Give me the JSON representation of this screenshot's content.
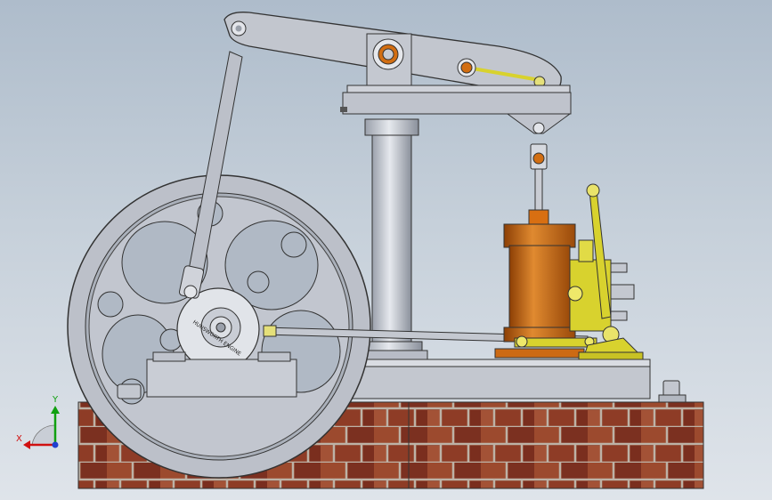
{
  "viewport": {
    "app": "CAD model viewport",
    "model": "beam-engine-assembly",
    "background": {
      "top": "#aebccb",
      "bottom": "#dfe4ea"
    }
  },
  "flywheel": {
    "label_text": "HUNSWORTH ENGINE",
    "label_visible_as_graphic": true
  },
  "triad": {
    "x_label": "X",
    "y_label": "Y",
    "x_color": "#d01010",
    "y_color": "#10a010",
    "z_color": "#2040d0"
  },
  "colors": {
    "steel": "#bfc3cc",
    "steel_dark": "#6f7480",
    "steel_light": "#e2e5ea",
    "copper": "#c8650f",
    "copper_dark": "#8c3f05",
    "brass": "#d8d22e",
    "brass_dark": "#8a8410",
    "brick": "#8a3a24",
    "mortar": "#b9aea4"
  },
  "icons": [
    "coordinate-triad-icon"
  ]
}
